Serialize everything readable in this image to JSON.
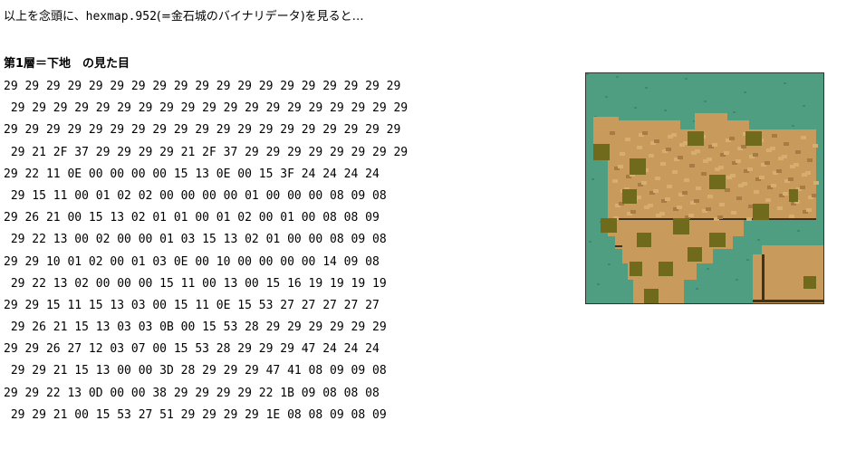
{
  "intro": {
    "prefix": "以上を念頭に、",
    "code": "hexmap.952",
    "suffix": "(=金石城のバイナリデータ)を見ると…"
  },
  "heading": "第1層＝下地　の見た目",
  "hex_rows": [
    "29 29 29 29 29 29 29 29 29 29 29 29 29 29 29 29 29 29 29",
    " 29 29 29 29 29 29 29 29 29 29 29 29 29 29 29 29 29 29 29",
    "29 29 29 29 29 29 29 29 29 29 29 29 29 29 29 29 29 29 29",
    " 29 21 2F 37 29 29 29 29 21 2F 37 29 29 29 29 29 29 29 29",
    "29 22 11 0E 00 00 00 00 15 13 0E 00 15 3F 24 24 24 24",
    " 29 15 11 00 01 02 02 00 00 00 00 01 00 00 00 08 09 08",
    "29 26 21 00 15 13 02 01 01 00 01 02 00 01 00 08 08 09",
    " 29 22 13 00 02 00 00 01 03 15 13 02 01 00 00 08 09 08",
    "29 29 10 01 02 00 01 03 0E 00 10 00 00 00 00 14 09 08",
    " 29 22 13 02 00 00 00 15 11 00 13 00 15 16 19 19 19 19",
    "29 29 15 11 15 13 03 00 15 11 0E 15 53 27 27 27 27 27",
    " 29 26 21 15 13 03 03 0B 00 15 53 28 29 29 29 29 29 29",
    "29 29 26 27 12 03 07 00 15 53 28 29 29 29 47 24 24 24",
    " 29 29 21 15 13 00 00 3D 28 29 29 29 47 41 08 09 09 08",
    "29 29 22 13 0D 00 00 38 29 29 29 29 22 1B 09 08 08 08",
    " 29 29 21 00 15 53 27 51 29 29 29 29 1E 08 08 09 08 09"
  ],
  "map_colors": {
    "water": "#4f9e82",
    "water_dark": "#3f8a6f",
    "ground": "#c89a5c",
    "ground_dark": "#a87b44",
    "ground_light": "#d8ad70",
    "bush": "#6f6a1c",
    "cliff": "#3b3424",
    "frame": "#333333"
  }
}
